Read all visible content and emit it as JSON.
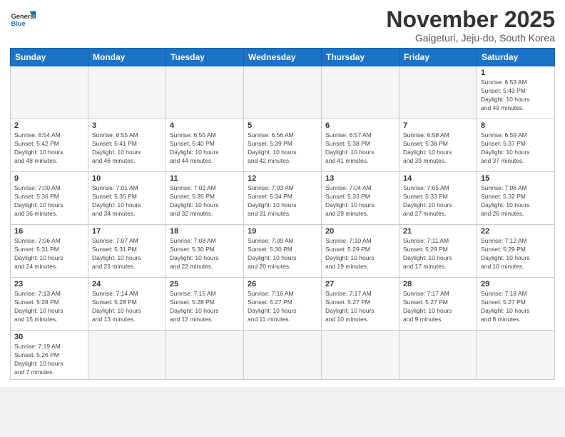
{
  "logo": {
    "general": "General",
    "blue": "Blue"
  },
  "header": {
    "title": "November 2025",
    "subtitle": "Gaigeturi, Jeju-do, South Korea"
  },
  "weekdays": [
    "Sunday",
    "Monday",
    "Tuesday",
    "Wednesday",
    "Thursday",
    "Friday",
    "Saturday"
  ],
  "weeks": [
    [
      null,
      null,
      null,
      null,
      null,
      null,
      {
        "day": 1,
        "sunrise": "6:53 AM",
        "sunset": "5:43 PM",
        "daylight_h": 10,
        "daylight_m": 49
      }
    ],
    [
      {
        "day": 2,
        "sunrise": "6:54 AM",
        "sunset": "5:42 PM",
        "daylight_h": 10,
        "daylight_m": 48
      },
      {
        "day": 3,
        "sunrise": "6:55 AM",
        "sunset": "5:41 PM",
        "daylight_h": 10,
        "daylight_m": 46
      },
      {
        "day": 4,
        "sunrise": "6:55 AM",
        "sunset": "5:40 PM",
        "daylight_h": 10,
        "daylight_m": 44
      },
      {
        "day": 5,
        "sunrise": "6:56 AM",
        "sunset": "5:39 PM",
        "daylight_h": 10,
        "daylight_m": 42
      },
      {
        "day": 6,
        "sunrise": "6:57 AM",
        "sunset": "5:38 PM",
        "daylight_h": 10,
        "daylight_m": 41
      },
      {
        "day": 7,
        "sunrise": "6:58 AM",
        "sunset": "5:38 PM",
        "daylight_h": 10,
        "daylight_m": 39
      },
      {
        "day": 8,
        "sunrise": "6:59 AM",
        "sunset": "5:37 PM",
        "daylight_h": 10,
        "daylight_m": 37
      }
    ],
    [
      {
        "day": 9,
        "sunrise": "7:00 AM",
        "sunset": "5:36 PM",
        "daylight_h": 10,
        "daylight_m": 36
      },
      {
        "day": 10,
        "sunrise": "7:01 AM",
        "sunset": "5:35 PM",
        "daylight_h": 10,
        "daylight_m": 34
      },
      {
        "day": 11,
        "sunrise": "7:02 AM",
        "sunset": "5:35 PM",
        "daylight_h": 10,
        "daylight_m": 32
      },
      {
        "day": 12,
        "sunrise": "7:03 AM",
        "sunset": "5:34 PM",
        "daylight_h": 10,
        "daylight_m": 31
      },
      {
        "day": 13,
        "sunrise": "7:04 AM",
        "sunset": "5:33 PM",
        "daylight_h": 10,
        "daylight_m": 29
      },
      {
        "day": 14,
        "sunrise": "7:05 AM",
        "sunset": "5:33 PM",
        "daylight_h": 10,
        "daylight_m": 27
      },
      {
        "day": 15,
        "sunrise": "7:06 AM",
        "sunset": "5:32 PM",
        "daylight_h": 10,
        "daylight_m": 26
      }
    ],
    [
      {
        "day": 16,
        "sunrise": "7:06 AM",
        "sunset": "5:31 PM",
        "daylight_h": 10,
        "daylight_m": 24
      },
      {
        "day": 17,
        "sunrise": "7:07 AM",
        "sunset": "5:31 PM",
        "daylight_h": 10,
        "daylight_m": 23
      },
      {
        "day": 18,
        "sunrise": "7:08 AM",
        "sunset": "5:30 PM",
        "daylight_h": 10,
        "daylight_m": 22
      },
      {
        "day": 19,
        "sunrise": "7:09 AM",
        "sunset": "5:30 PM",
        "daylight_h": 10,
        "daylight_m": 20
      },
      {
        "day": 20,
        "sunrise": "7:10 AM",
        "sunset": "5:29 PM",
        "daylight_h": 10,
        "daylight_m": 19
      },
      {
        "day": 21,
        "sunrise": "7:11 AM",
        "sunset": "5:29 PM",
        "daylight_h": 10,
        "daylight_m": 17
      },
      {
        "day": 22,
        "sunrise": "7:12 AM",
        "sunset": "5:29 PM",
        "daylight_h": 10,
        "daylight_m": 16
      }
    ],
    [
      {
        "day": 23,
        "sunrise": "7:13 AM",
        "sunset": "5:28 PM",
        "daylight_h": 10,
        "daylight_m": 15
      },
      {
        "day": 24,
        "sunrise": "7:14 AM",
        "sunset": "5:28 PM",
        "daylight_h": 10,
        "daylight_m": 13
      },
      {
        "day": 25,
        "sunrise": "7:15 AM",
        "sunset": "5:28 PM",
        "daylight_h": 10,
        "daylight_m": 12
      },
      {
        "day": 26,
        "sunrise": "7:16 AM",
        "sunset": "5:27 PM",
        "daylight_h": 10,
        "daylight_m": 11
      },
      {
        "day": 27,
        "sunrise": "7:17 AM",
        "sunset": "5:27 PM",
        "daylight_h": 10,
        "daylight_m": 10
      },
      {
        "day": 28,
        "sunrise": "7:17 AM",
        "sunset": "5:27 PM",
        "daylight_h": 10,
        "daylight_m": 9
      },
      {
        "day": 29,
        "sunrise": "7:18 AM",
        "sunset": "5:27 PM",
        "daylight_h": 10,
        "daylight_m": 8
      }
    ],
    [
      {
        "day": 30,
        "sunrise": "7:19 AM",
        "sunset": "5:26 PM",
        "daylight_h": 10,
        "daylight_m": 7
      },
      null,
      null,
      null,
      null,
      null,
      null
    ]
  ]
}
